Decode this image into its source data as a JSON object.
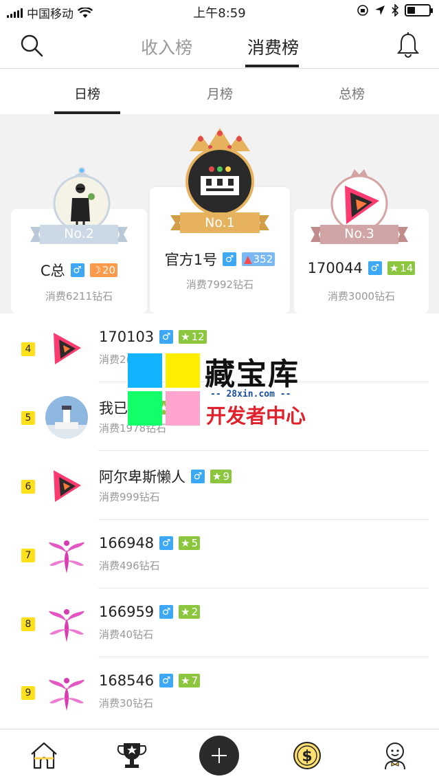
{
  "status_bar": {
    "carrier": "中国移动",
    "time": "上午8:59",
    "battery_level": 0.35
  },
  "top_tabs": [
    {
      "label": "收入榜",
      "active": false
    },
    {
      "label": "消费榜",
      "active": true
    }
  ],
  "sub_tabs": [
    {
      "label": "日榜",
      "active": true
    },
    {
      "label": "月榜",
      "active": false
    },
    {
      "label": "总榜",
      "active": false
    }
  ],
  "podium": {
    "first": {
      "badge": "No.1",
      "name": "官方1号",
      "gender": "♂",
      "level": "352",
      "spend": "消费7992钻石"
    },
    "second": {
      "badge": "No.2",
      "name": "C总",
      "gender": "♂",
      "level": "20",
      "spend": "消费6211钻石"
    },
    "third": {
      "badge": "No.3",
      "name": "170044",
      "gender": "♂",
      "level": "14",
      "spend": "消费3000钻石"
    }
  },
  "list": [
    {
      "rank": "4",
      "name": "170103",
      "gender": "♂",
      "level": "12",
      "spend": "消费2("
    },
    {
      "rank": "5",
      "name": "我已,",
      "gender": "♂",
      "level": "2",
      "spend": "消费1978钻石"
    },
    {
      "rank": "6",
      "name": "阿尔卑斯懒人",
      "gender": "♂",
      "level": "9",
      "spend": "消费999钻石"
    },
    {
      "rank": "7",
      "name": "166948",
      "gender": "♂",
      "level": "5",
      "spend": "消费496钻石"
    },
    {
      "rank": "8",
      "name": "166959",
      "gender": "♂",
      "level": "2",
      "spend": "消费40钻石"
    },
    {
      "rank": "9",
      "name": "168546",
      "gender": "♂",
      "level": "7",
      "spend": "消费30钻石"
    }
  ],
  "watermark": {
    "title": "藏宝库",
    "url": "-- 28xin.com --",
    "subtitle": "开发者中心"
  },
  "colors": {
    "male": "#3da8f5",
    "level_green": "#8cc63f",
    "level_orange": "#ff9a4a",
    "rank_badge": "#ffe01a",
    "gold": "#e6b25e"
  }
}
